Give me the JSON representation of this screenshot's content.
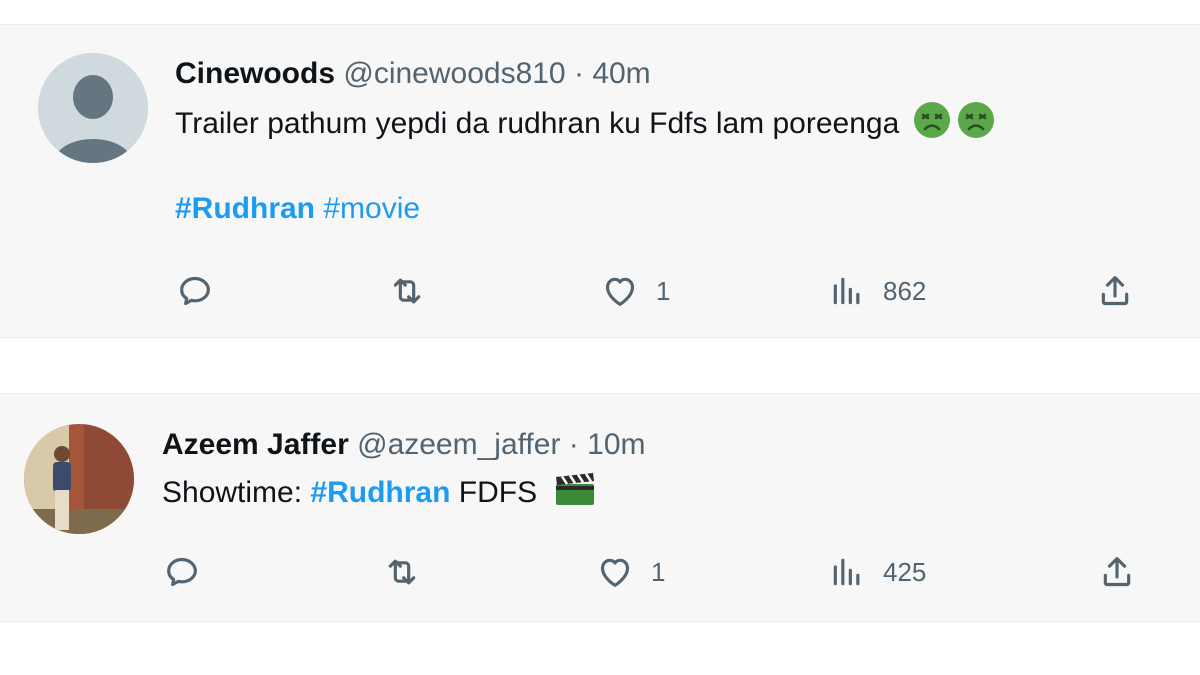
{
  "tweets": [
    {
      "display_name": "Cinewoods",
      "handle": "@cinewoods810",
      "separator": "·",
      "time": "40m",
      "text": "Trailer pathum yepdi da rudhran ku Fdfs lam poreenga",
      "emojis": [
        "nauseated-face",
        "nauseated-face"
      ],
      "hashtags": [
        "#Rudhran",
        "#movie"
      ],
      "reply_icon": "reply-icon",
      "retweet_icon": "retweet-icon",
      "like_icon": "heart-icon",
      "likes": "1",
      "views_icon": "views-chart-icon",
      "views": "862",
      "share_icon": "share-icon"
    },
    {
      "display_name": "Azeem Jaffer",
      "handle": "@azeem_jaffer",
      "separator": "·",
      "time": "10m",
      "text_prefix": "Showtime:",
      "hashtag": "#Rudhran",
      "text_suffix": "FDFS",
      "emoji": "clapper-board",
      "reply_icon": "reply-icon",
      "retweet_icon": "retweet-icon",
      "like_icon": "heart-icon",
      "likes": "1",
      "views_icon": "views-chart-icon",
      "views": "425",
      "share_icon": "share-icon"
    }
  ],
  "colors": {
    "hashtag": "#1d9bf0",
    "muted": "#536471",
    "card_bg": "#f7f7f7"
  }
}
